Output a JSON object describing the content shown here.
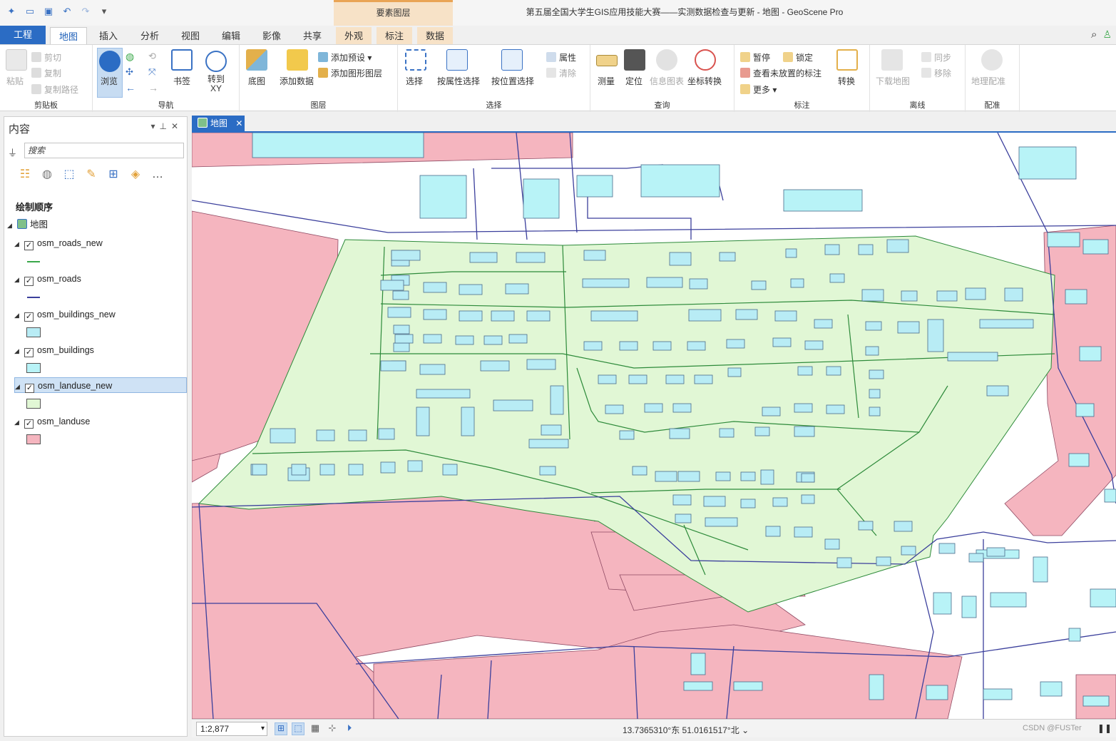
{
  "window": {
    "title": "第五届全国大学生GIS应用技能大赛——实测数据检查与更新 - 地图 - GeoScene Pro"
  },
  "ribbon_context": {
    "label": "要素图层"
  },
  "tabs": [
    {
      "label": "工程"
    },
    {
      "label": "地图"
    },
    {
      "label": "插入"
    },
    {
      "label": "分析"
    },
    {
      "label": "视图"
    },
    {
      "label": "编辑"
    },
    {
      "label": "影像"
    },
    {
      "label": "共享"
    },
    {
      "label": "外观"
    },
    {
      "label": "标注"
    },
    {
      "label": "数据"
    }
  ],
  "ribbon": {
    "clipboard": {
      "paste": "粘贴",
      "cut": "剪切",
      "copy": "复制",
      "copy_path": "复制路径",
      "label": "剪贴板"
    },
    "navigate": {
      "explore": "浏览",
      "bookmarks": "书签",
      "goto_xy": "转到\nXY",
      "label": "导航"
    },
    "layer": {
      "basemap": "底图",
      "add_data": "添加数据",
      "add_preset": "添加预设",
      "add_graphics": "添加图形图层",
      "label": "图层"
    },
    "selection": {
      "select": "选择",
      "by_attr": "按属性选择",
      "by_loc": "按位置选择",
      "attributes": "属性",
      "clear": "清除",
      "label": "选择"
    },
    "inquiry": {
      "measure": "测量",
      "locate": "定位",
      "infographics": "信息图表",
      "convert_coords": "坐标转换",
      "label": "查询"
    },
    "labeling": {
      "pause": "暂停",
      "lock": "锁定",
      "view_unplaced": "查看未放置的标注",
      "more": "更多",
      "convert": "转换",
      "label": "标注"
    },
    "offline": {
      "download": "下载地图",
      "sync": "同步",
      "remove": "移除",
      "label": "离线"
    },
    "georef": {
      "georeference": "地理配准",
      "label": "配准"
    }
  },
  "contents": {
    "title": "内容",
    "search_placeholder": "搜索",
    "draw_order": "绘制顺序",
    "map_node": "地图",
    "layers": [
      {
        "name": "osm_roads_new",
        "checked": true,
        "symbol": "line",
        "color": "#3aa84a"
      },
      {
        "name": "osm_roads",
        "checked": true,
        "symbol": "line",
        "color": "#3b3f9c"
      },
      {
        "name": "osm_buildings_new",
        "checked": true,
        "symbol": "box",
        "color": "#b8ecf5"
      },
      {
        "name": "osm_buildings",
        "checked": true,
        "symbol": "box",
        "color": "#b8f3f7"
      },
      {
        "name": "osm_landuse_new",
        "checked": true,
        "symbol": "box",
        "color": "#e1f7d5",
        "selected": true
      },
      {
        "name": "osm_landuse",
        "checked": true,
        "symbol": "box",
        "color": "#f5b5bf"
      }
    ]
  },
  "map_view": {
    "tab_label": "地图"
  },
  "status": {
    "scale": "1:2,877",
    "coordinates": "13.7365310°东 51.0161517°北",
    "watermark": "CSDN @FUSTer"
  },
  "colors": {
    "accent": "#2b6cc4",
    "landuse_pink": "#f5b5bf",
    "landuse_new_green": "#e1f7d5",
    "building_cyan": "#b8f3f7",
    "road_purple": "#3b3f9c",
    "road_new_green": "#3aa84a"
  }
}
